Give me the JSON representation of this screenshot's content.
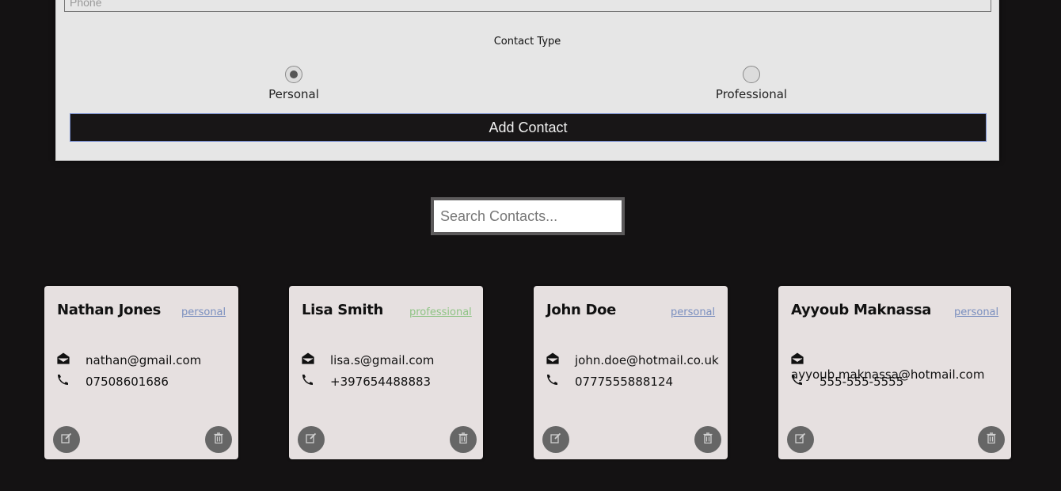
{
  "form": {
    "phone_placeholder": "Phone",
    "contact_type_label": "Contact Type",
    "radio_personal_label": "Personal",
    "radio_professional_label": "Professional",
    "selected_type": "Personal",
    "add_button_label": "Add Contact"
  },
  "search": {
    "placeholder": "Search Contacts..."
  },
  "icons": {
    "email": "envelope-open-icon",
    "phone": "phone-icon",
    "edit": "edit-icon",
    "delete": "trash-icon"
  },
  "colors": {
    "personal_badge": "#7a8fbf",
    "professional_badge": "#8fc485",
    "background": "#141213"
  },
  "contacts": [
    {
      "name": "Nathan Jones",
      "type": "personal",
      "email": "nathan@gmail.com",
      "phone": "07508601686"
    },
    {
      "name": "Lisa Smith",
      "type": "professional",
      "email": "lisa.s@gmail.com",
      "phone": "+397654488883"
    },
    {
      "name": "John Doe",
      "type": "personal",
      "email": "john.doe@hotmail.co.uk",
      "phone": "0777555888124"
    },
    {
      "name": "Ayyoub Maknassa",
      "type": "personal",
      "email": "ayyoub.maknassa@hotmail.com",
      "phone": "555-555-5555"
    }
  ]
}
